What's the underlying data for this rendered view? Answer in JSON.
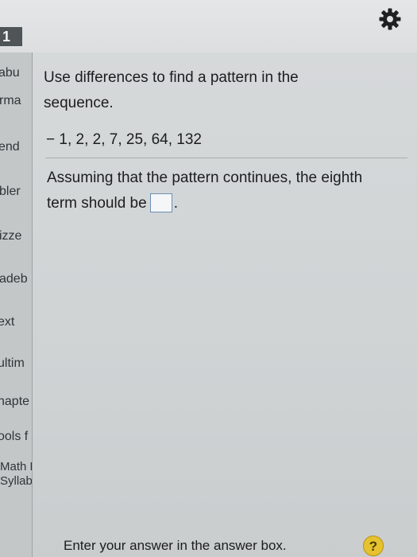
{
  "header": {
    "tab_number": "1",
    "settings_icon": "gear-icon"
  },
  "sidebar": {
    "items": [
      {
        "label": "abu"
      },
      {
        "label": "rma"
      },
      {
        "label": "end"
      },
      {
        "label": "bler"
      },
      {
        "label": "izze"
      },
      {
        "label": "adeb"
      },
      {
        "label": "ext"
      },
      {
        "label": "ultim"
      },
      {
        "label": "hapte"
      },
      {
        "label": "ools f"
      },
      {
        "label": "Math D"
      },
      {
        "label": "Syllabu"
      }
    ]
  },
  "question": {
    "instruction": "Use differences to find a pattern in the sequence.",
    "sequence": "− 1, 2, 2, 7, 25, 64, 132",
    "prompt_before": "Assuming that the pattern continues, the eighth term should be",
    "prompt_after": "."
  },
  "footer": {
    "hint": "Enter your answer in the answer box.",
    "help_label": "?"
  },
  "colors": {
    "help_button": "#e6c22f",
    "tab_background": "#4f5557"
  }
}
